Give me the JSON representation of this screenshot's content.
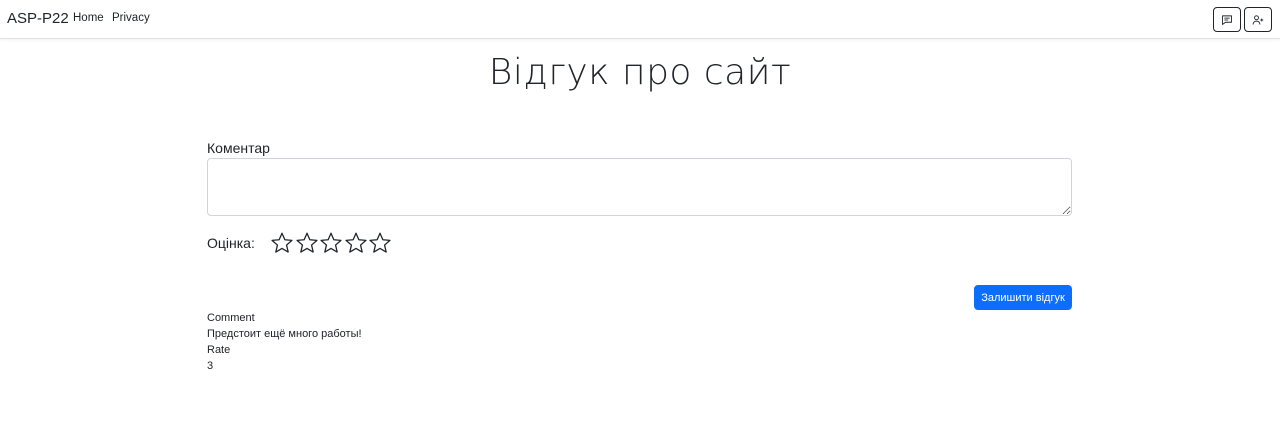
{
  "navbar": {
    "brand": "ASP-P22",
    "links": [
      "Home",
      "Privacy"
    ],
    "icons": [
      "chat-icon",
      "person-add-icon"
    ]
  },
  "feedback": {
    "title": "Відгук про сайт",
    "comment_label": "Коментар",
    "comment_value": "",
    "rate_label": "Оцінка:",
    "stars_total": 5,
    "stars_selected": 0,
    "submit_label": "Залишити відгук"
  },
  "result": {
    "comment_heading": "Comment",
    "comment_value": "Предстоит ещё много работы!",
    "rate_heading": "Rate",
    "rate_value": "3"
  },
  "colors": {
    "primary": "#0d6efd",
    "text": "#212529",
    "border": "#ced4da"
  }
}
